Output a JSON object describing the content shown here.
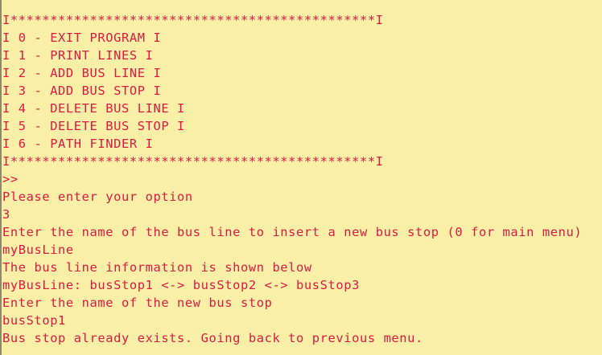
{
  "console": {
    "lines": [
      "I**********************************************I",
      "I 0 - EXIT PROGRAM I",
      "I 1 - PRINT LINES I",
      "I 2 - ADD BUS LINE I",
      "I 3 - ADD BUS STOP I",
      "I 4 - DELETE BUS LINE I",
      "I 5 - DELETE BUS STOP I",
      "I 6 - PATH FINDER I",
      "I**********************************************I",
      ">>",
      "Please enter your option",
      "3",
      "Enter the name of the bus line to insert a new bus stop (0 for main menu)",
      "myBusLine",
      "The bus line information is shown below",
      "myBusLine: busStop1 <-> busStop2 <-> busStop3",
      "Enter the name of the new bus stop",
      "busStop1",
      "Bus stop already exists. Going back to previous menu."
    ],
    "text_color": "#d91b45",
    "background_color": "#f9efa6"
  }
}
